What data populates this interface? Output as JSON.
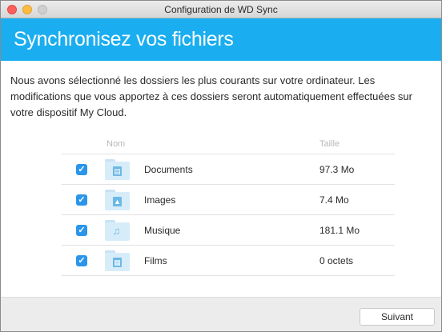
{
  "window": {
    "title": "Configuration de WD Sync"
  },
  "header": {
    "title": "Synchronisez vos fichiers",
    "background": "#1aaef0"
  },
  "intro": "Nous avons sélectionné les dossiers les plus courants sur votre ordinateur. Les modifications que vous apportez à ces dossiers seront automatiquement effectuées sur votre dispositif My Cloud.",
  "table": {
    "columns": {
      "name": "Nom",
      "size": "Taille"
    },
    "rows": [
      {
        "checked": true,
        "icon": "document-folder-icon",
        "name": "Documents",
        "size": "97.3 Mo"
      },
      {
        "checked": true,
        "icon": "image-folder-icon",
        "name": "Images",
        "size": "7.4 Mo"
      },
      {
        "checked": true,
        "icon": "music-folder-icon",
        "name": "Musique",
        "size": "181.1 Mo"
      },
      {
        "checked": true,
        "icon": "film-folder-icon",
        "name": "Films",
        "size": "0 octets"
      }
    ]
  },
  "footer": {
    "next_label": "Suivant"
  },
  "colors": {
    "accent": "#1aaef0",
    "checkbox": "#2a95ea"
  }
}
